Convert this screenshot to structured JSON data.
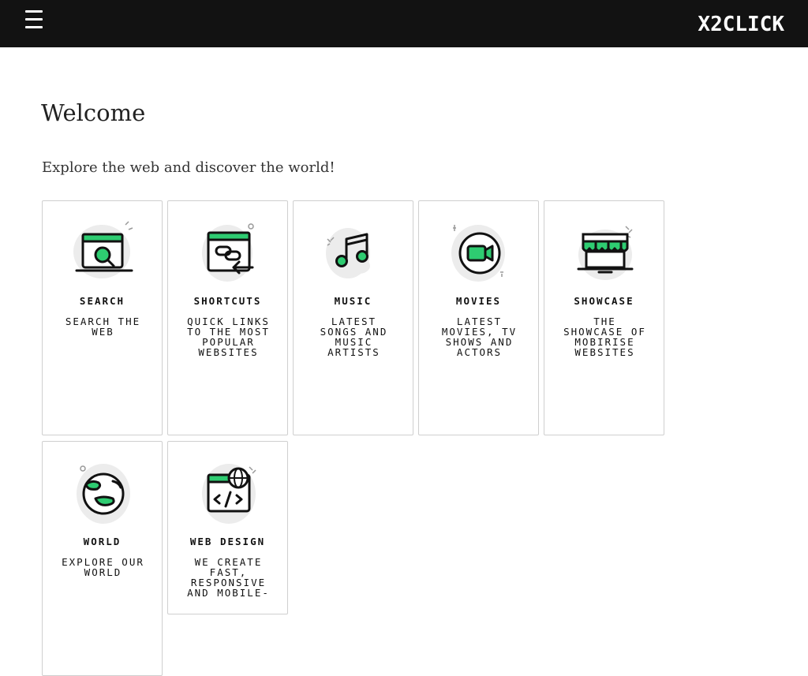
{
  "header": {
    "menu_icon": "hamburger-menu-icon",
    "logo": "X2CLICK"
  },
  "main": {
    "title": "Welcome",
    "subtitle": "Explore the web and discover the world!"
  },
  "colors": {
    "accent": "#2ecc71",
    "topbar": "#121212",
    "blob": "#ececec"
  },
  "cards": [
    {
      "title": "SEARCH",
      "description": "SEARCH THE WEB",
      "icon": "search-window-icon"
    },
    {
      "title": "SHORTCUTS",
      "description": "QUICK LINKS TO THE MOST POPULAR WEBSITES",
      "icon": "link-window-icon"
    },
    {
      "title": "MUSIC",
      "description": "LATEST SONGS AND MUSIC ARTISTS",
      "icon": "music-note-icon"
    },
    {
      "title": "MOVIES",
      "description": "LATEST MOVIES, TV SHOWS AND ACTORS",
      "icon": "video-camera-icon"
    },
    {
      "title": "SHOWCASE",
      "description": "THE SHOWCASE OF MOBIRISE WEBSITES",
      "icon": "storefront-icon"
    },
    {
      "title": "WORLD",
      "description": "EXPLORE OUR WORLD",
      "icon": "globe-icon"
    },
    {
      "title": "WEB DESIGN",
      "description": "WE CREATE FAST, RESPONSIVE AND MOBILE-",
      "icon": "code-window-icon"
    }
  ]
}
